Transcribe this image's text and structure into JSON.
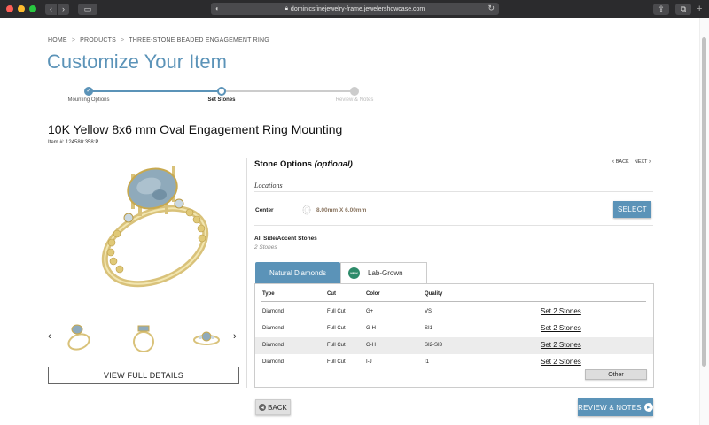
{
  "browser": {
    "url": "dominicsfinejewelry-frame.jewelershowcase.com"
  },
  "breadcrumb": [
    "HOME",
    "PRODUCTS",
    "THREE-STONE BEADED ENGAGEMENT RING"
  ],
  "page_title": "Customize Your Item",
  "progress": {
    "steps": [
      {
        "label": "Mounting Options",
        "state": "complete"
      },
      {
        "label": "Set Stones",
        "state": "current"
      },
      {
        "label": "Review & Notes",
        "state": "upcoming"
      }
    ]
  },
  "product": {
    "title": "10K Yellow 8x6 mm Oval Engagement Ring Mounting",
    "item_number": "Item #: 124580:358:P"
  },
  "gallery": {
    "view_details_label": "VIEW FULL DETAILS"
  },
  "stone_options": {
    "heading": "Stone Options",
    "heading_optional": "(optional)",
    "back_link": "< BACK",
    "next_link": "NEXT >",
    "locations_label": "Locations",
    "center": {
      "label": "Center",
      "size": "8.00mm X 6.00mm",
      "select_label": "SELECT"
    },
    "side": {
      "label": "All Side/Accent Stones",
      "count": "2 Stones"
    },
    "tabs": {
      "natural": "Natural Diamonds",
      "lab": "Lab-Grown",
      "new_badge": "NEW"
    },
    "table": {
      "headers": {
        "type": "Type",
        "cut": "Cut",
        "color": "Color",
        "quality": "Quality"
      },
      "rows": [
        {
          "type": "Diamond",
          "cut": "Full Cut",
          "color": "G+",
          "quality": "VS",
          "action": "Set 2 Stones"
        },
        {
          "type": "Diamond",
          "cut": "Full Cut",
          "color": "G-H",
          "quality": "SI1",
          "action": "Set 2 Stones"
        },
        {
          "type": "Diamond",
          "cut": "Full Cut",
          "color": "G-H",
          "quality": "SI2-SI3",
          "action": "Set 2 Stones"
        },
        {
          "type": "Diamond",
          "cut": "Full Cut",
          "color": "I-J",
          "quality": "I1",
          "action": "Set 2 Stones"
        }
      ],
      "other_label": "Other"
    }
  },
  "footer": {
    "back_label": "BACK",
    "review_label": "REVIEW & NOTES"
  },
  "colors": {
    "accent": "#5b93b8",
    "gold": "#d9c27a",
    "stone": "#8faabb"
  }
}
